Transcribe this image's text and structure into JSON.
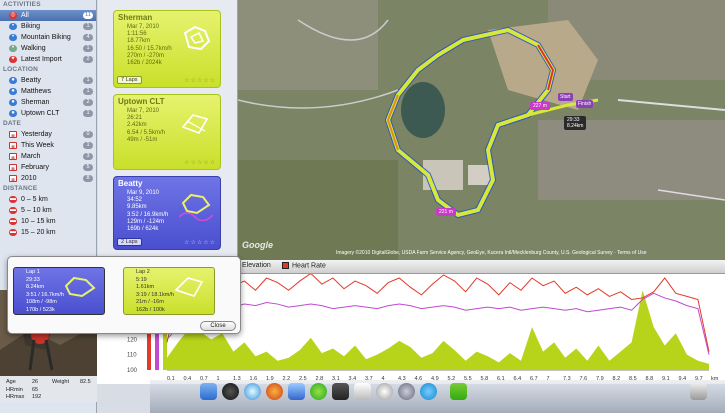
{
  "sidebar": {
    "sections": {
      "activities": "ACTIVITIES",
      "location": "LOCATION",
      "date": "DATE",
      "distance": "DISTANCE"
    },
    "activities": [
      {
        "label": "All",
        "count": "11"
      },
      {
        "label": "Biking",
        "count": "1"
      },
      {
        "label": "Mountain Biking",
        "count": "4"
      },
      {
        "label": "Walking",
        "count": "1"
      },
      {
        "label": "Latest Import",
        "count": "2"
      }
    ],
    "locations": [
      {
        "label": "Beatty",
        "count": "1"
      },
      {
        "label": "Matthews",
        "count": "1"
      },
      {
        "label": "Sherman",
        "count": "2"
      },
      {
        "label": "Uptown CLT",
        "count": "1"
      }
    ],
    "dates": [
      {
        "label": "Yesterday",
        "count": "0"
      },
      {
        "label": "This Week",
        "count": "1"
      },
      {
        "label": "March",
        "count": "3"
      },
      {
        "label": "February",
        "count": "5"
      },
      {
        "label": "2010",
        "count": "8"
      }
    ],
    "distances": [
      {
        "label": "0 – 5 km",
        "count": ""
      },
      {
        "label": "5 – 10 km",
        "count": ""
      },
      {
        "label": "10 – 15 km",
        "count": ""
      },
      {
        "label": "15 – 20 km",
        "count": ""
      }
    ]
  },
  "cards": [
    {
      "title": "Sherman",
      "temp": "17.6°C",
      "date": "Mar 7, 2010",
      "duration": "1:11:56",
      "distance": "18.77km",
      "speed": "16.50 / 15.7km/h",
      "elevation": "270m / -270m",
      "heart": "162b / 2024k",
      "laps": "7 Laps"
    },
    {
      "title": "Uptown CLT",
      "temp": "17.6°C",
      "date": "Mar 7, 2010",
      "duration": "26:21",
      "distance": "2.42km",
      "speed": "6.54 / 5.5km/h",
      "elevation": "49m / -51m",
      "heart": ""
    },
    {
      "title": "Beatty",
      "temp": "17.6°C",
      "date": "Mar 9, 2010",
      "duration": "34:52",
      "distance": "9.85km",
      "speed": "3:52 / 16.9km/h",
      "elevation": "129m / -124m",
      "heart": "169b / 624k",
      "laps": "2 Laps"
    }
  ],
  "laps_popup": {
    "laps": [
      {
        "title": "Lap 1",
        "duration": "29:33",
        "distance": "8.24km",
        "speed": "3:51 / 16.7km/h",
        "elevation": "108m / -98m",
        "heart": "170b / 523k"
      },
      {
        "title": "Lap 2",
        "duration": "5:19",
        "distance": "1.61km",
        "speed": "3:19 / 18.1km/h",
        "elevation": "21m / -16m",
        "heart": "162b / 100k"
      }
    ],
    "close_label": "Close"
  },
  "map": {
    "copyright": "Imagery ©2010 DigitalGlobe, USDA Farm Service Agency, GeoEye, Kucera Intl/Mecklenburg County, U.S. Geological Survey · Terms of Use",
    "logo": "Google",
    "start_label": "Start",
    "finish_label": "Finish",
    "marker_1": "227 m",
    "marker_2": "221 m",
    "info_time": "29:33",
    "info_dist": "8.24km"
  },
  "chart_tabs": {
    "elevation": "Elevation",
    "heart_rate": "Heart Rate"
  },
  "chart_data": {
    "type": "line",
    "x": [
      0,
      0.2,
      0.4,
      0.6,
      0.8,
      1,
      1.2,
      1.4,
      1.6,
      1.8,
      2,
      2.2,
      2.4,
      2.6,
      2.8,
      3,
      3.2,
      3.4,
      3.6,
      3.8,
      4,
      4.2,
      4.4,
      4.6,
      4.8,
      5,
      5.2,
      5.4,
      5.6,
      5.8,
      6,
      6.2,
      6.4,
      6.6,
      6.8,
      7,
      7.2,
      7.4,
      7.6,
      7.8,
      8,
      8.2,
      8.4,
      8.6,
      8.8,
      9,
      9.2,
      9.4,
      9.6,
      9.8
    ],
    "xticks": [
      "0.1",
      "0.4",
      "0.7",
      "1",
      "1.3",
      "1.6",
      "1.9",
      "2.2",
      "2.5",
      "2.8",
      "3.1",
      "3.4",
      "3.7",
      "4",
      "4.3",
      "4.6",
      "4.9",
      "5.2",
      "5.5",
      "5.8",
      "6.1",
      "6.4",
      "6.7",
      "7",
      "7.3",
      "7.6",
      "7.9",
      "8.2",
      "8.5",
      "8.8",
      "9.1",
      "9.4",
      "9.7"
    ],
    "xunit": "km",
    "yticks": [
      "100",
      "110",
      "120",
      "130",
      "140",
      "150",
      "160"
    ],
    "series": [
      {
        "name": "Heart Rate",
        "color": "#e23a2a",
        "values": [
          118,
          150,
          157,
          160,
          156,
          162,
          155,
          158,
          152,
          160,
          157,
          152,
          158,
          163,
          156,
          160,
          153,
          158,
          155,
          150,
          157,
          160,
          154,
          149,
          156,
          162,
          158,
          151,
          160,
          156,
          149,
          157,
          152,
          160,
          155,
          158,
          150,
          154,
          149,
          153,
          148,
          151,
          146,
          147,
          151,
          160,
          150,
          148,
          146,
          112
        ]
      },
      {
        "name": "Speed",
        "color": "#c04ad0",
        "values": [
          120,
          128,
          133,
          138,
          140,
          142,
          141,
          143,
          142,
          144,
          143,
          141,
          142,
          143,
          142,
          140,
          141,
          142,
          141,
          140,
          142,
          143,
          142,
          140,
          141,
          142,
          141,
          139,
          140,
          141,
          140,
          141,
          139,
          140,
          141,
          140,
          139,
          140,
          138,
          139,
          140,
          141,
          139,
          146,
          150,
          147,
          145,
          142,
          140,
          110
        ]
      },
      {
        "name": "Elevation",
        "color": "#b8d41a",
        "values": [
          108,
          118,
          127,
          125,
          120,
          124,
          112,
          118,
          109,
          112,
          106,
          108,
          113,
          121,
          111,
          114,
          109,
          116,
          107,
          110,
          114,
          119,
          115,
          108,
          111,
          119,
          113,
          106,
          112,
          109,
          105,
          111,
          106,
          128,
          112,
          118,
          108,
          114,
          106,
          116,
          106,
          112,
          118,
          152,
          128,
          116,
          124,
          110,
          106,
          104
        ]
      }
    ]
  },
  "stats": {
    "age_label": "Age",
    "age": "26",
    "weight_label": "Weight",
    "weight": "82.5",
    "hrmin_label": "HRmin",
    "hrmin": "65",
    "hrmax_label": "HRmax",
    "hrmax": "192"
  },
  "dock_icons": [
    "finder-icon",
    "dashboard-icon",
    "safari-icon",
    "firefox-icon",
    "itunes-icon",
    "spotify-icon",
    "app-icon",
    "bars-icon",
    "clock-icon",
    "settings-icon",
    "skype-icon",
    "trash-icon"
  ]
}
